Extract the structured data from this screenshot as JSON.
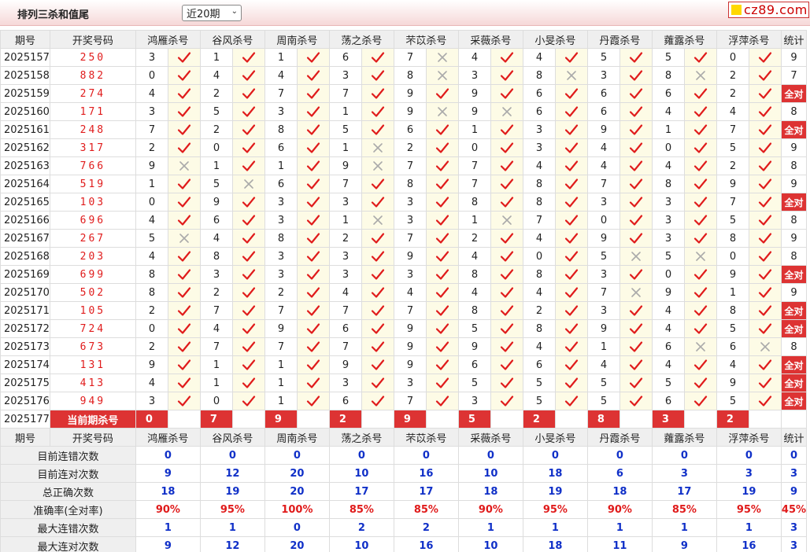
{
  "header": {
    "title": "排列三杀和值尾",
    "period_select": "近20期",
    "logo_text": "cz89.com"
  },
  "columns": {
    "period": "期号",
    "draw": "开奖号码",
    "experts": [
      "鸿雁杀号",
      "谷风杀号",
      "周南杀号",
      "荡之杀号",
      "芣苡杀号",
      "采薇杀号",
      "小旻杀号",
      "丹霞杀号",
      "蕹露杀号",
      "浮萍杀号"
    ],
    "count": "统计"
  },
  "full_label": "全对",
  "rows": [
    {
      "period": "2025157",
      "draw": "250",
      "kills": [
        3,
        1,
        1,
        6,
        7,
        4,
        4,
        5,
        5,
        0
      ],
      "hits": [
        1,
        1,
        1,
        1,
        0,
        1,
        1,
        1,
        1,
        1
      ],
      "count": "9"
    },
    {
      "period": "2025158",
      "draw": "882",
      "kills": [
        0,
        4,
        4,
        3,
        8,
        3,
        8,
        3,
        8,
        2
      ],
      "hits": [
        1,
        1,
        1,
        1,
        0,
        1,
        0,
        1,
        0,
        1
      ],
      "count": "7"
    },
    {
      "period": "2025159",
      "draw": "274",
      "kills": [
        4,
        2,
        7,
        7,
        9,
        9,
        6,
        6,
        6,
        2
      ],
      "hits": [
        1,
        1,
        1,
        1,
        1,
        1,
        1,
        1,
        1,
        1
      ],
      "count": "全对"
    },
    {
      "period": "2025160",
      "draw": "171",
      "kills": [
        3,
        5,
        3,
        1,
        9,
        9,
        6,
        6,
        4,
        4
      ],
      "hits": [
        1,
        1,
        1,
        1,
        0,
        0,
        1,
        1,
        1,
        1
      ],
      "count": "8"
    },
    {
      "period": "2025161",
      "draw": "248",
      "kills": [
        7,
        2,
        8,
        5,
        6,
        1,
        3,
        9,
        1,
        7
      ],
      "hits": [
        1,
        1,
        1,
        1,
        1,
        1,
        1,
        1,
        1,
        1
      ],
      "count": "全对"
    },
    {
      "period": "2025162",
      "draw": "317",
      "kills": [
        2,
        0,
        6,
        1,
        2,
        0,
        3,
        4,
        0,
        5
      ],
      "hits": [
        1,
        1,
        1,
        0,
        1,
        1,
        1,
        1,
        1,
        1
      ],
      "count": "9"
    },
    {
      "period": "2025163",
      "draw": "766",
      "kills": [
        9,
        1,
        1,
        9,
        7,
        7,
        4,
        4,
        4,
        2
      ],
      "hits": [
        0,
        1,
        1,
        0,
        1,
        1,
        1,
        1,
        1,
        1
      ],
      "count": "8"
    },
    {
      "period": "2025164",
      "draw": "519",
      "kills": [
        1,
        5,
        6,
        7,
        8,
        7,
        8,
        7,
        8,
        9
      ],
      "hits": [
        1,
        0,
        1,
        1,
        1,
        1,
        1,
        1,
        1,
        1
      ],
      "count": "9"
    },
    {
      "period": "2025165",
      "draw": "103",
      "kills": [
        0,
        9,
        3,
        3,
        3,
        8,
        8,
        3,
        3,
        7
      ],
      "hits": [
        1,
        1,
        1,
        1,
        1,
        1,
        1,
        1,
        1,
        1
      ],
      "count": "全对"
    },
    {
      "period": "2025166",
      "draw": "696",
      "kills": [
        4,
        6,
        3,
        1,
        3,
        1,
        7,
        0,
        3,
        5
      ],
      "hits": [
        1,
        1,
        1,
        0,
        1,
        0,
        1,
        1,
        1,
        1
      ],
      "count": "8"
    },
    {
      "period": "2025167",
      "draw": "267",
      "kills": [
        5,
        4,
        8,
        2,
        7,
        2,
        4,
        9,
        3,
        8
      ],
      "hits": [
        0,
        1,
        1,
        1,
        1,
        1,
        1,
        1,
        1,
        1
      ],
      "count": "9"
    },
    {
      "period": "2025168",
      "draw": "203",
      "kills": [
        4,
        8,
        3,
        3,
        9,
        4,
        0,
        5,
        5,
        0
      ],
      "hits": [
        1,
        1,
        1,
        1,
        1,
        1,
        1,
        0,
        0,
        1
      ],
      "count": "8"
    },
    {
      "period": "2025169",
      "draw": "699",
      "kills": [
        8,
        3,
        3,
        3,
        3,
        8,
        8,
        3,
        0,
        9
      ],
      "hits": [
        1,
        1,
        1,
        1,
        1,
        1,
        1,
        1,
        1,
        1
      ],
      "count": "全对"
    },
    {
      "period": "2025170",
      "draw": "502",
      "kills": [
        8,
        2,
        2,
        4,
        4,
        4,
        4,
        7,
        9,
        1
      ],
      "hits": [
        1,
        1,
        1,
        1,
        1,
        1,
        1,
        0,
        1,
        1
      ],
      "count": "9"
    },
    {
      "period": "2025171",
      "draw": "105",
      "kills": [
        2,
        7,
        7,
        7,
        7,
        8,
        2,
        3,
        4,
        8
      ],
      "hits": [
        1,
        1,
        1,
        1,
        1,
        1,
        1,
        1,
        1,
        1
      ],
      "count": "全对"
    },
    {
      "period": "2025172",
      "draw": "724",
      "kills": [
        0,
        4,
        9,
        6,
        9,
        5,
        8,
        9,
        4,
        5
      ],
      "hits": [
        1,
        1,
        1,
        1,
        1,
        1,
        1,
        1,
        1,
        1
      ],
      "count": "全对"
    },
    {
      "period": "2025173",
      "draw": "673",
      "kills": [
        2,
        7,
        7,
        7,
        9,
        9,
        4,
        1,
        6,
        6
      ],
      "hits": [
        1,
        1,
        1,
        1,
        1,
        1,
        1,
        1,
        0,
        0
      ],
      "count": "8"
    },
    {
      "period": "2025174",
      "draw": "131",
      "kills": [
        9,
        1,
        1,
        9,
        9,
        6,
        6,
        4,
        4,
        4
      ],
      "hits": [
        1,
        1,
        1,
        1,
        1,
        1,
        1,
        1,
        1,
        1
      ],
      "count": "全对"
    },
    {
      "period": "2025175",
      "draw": "413",
      "kills": [
        4,
        1,
        1,
        3,
        3,
        5,
        5,
        5,
        5,
        9
      ],
      "hits": [
        1,
        1,
        1,
        1,
        1,
        1,
        1,
        1,
        1,
        1
      ],
      "count": "全对"
    },
    {
      "period": "2025176",
      "draw": "949",
      "kills": [
        3,
        0,
        1,
        6,
        7,
        3,
        5,
        5,
        6,
        5
      ],
      "hits": [
        1,
        1,
        1,
        1,
        1,
        1,
        1,
        1,
        1,
        1
      ],
      "count": "全对"
    }
  ],
  "current": {
    "period": "2025177",
    "label": "当前期杀号",
    "kills": [
      0,
      7,
      9,
      2,
      9,
      5,
      2,
      8,
      3,
      2
    ]
  },
  "stats": [
    {
      "label": "目前连错次数",
      "values": [
        "0",
        "0",
        "0",
        "0",
        "0",
        "0",
        "0",
        "0",
        "0",
        "0"
      ],
      "count": "0",
      "red": false
    },
    {
      "label": "目前连对次数",
      "values": [
        "9",
        "12",
        "20",
        "10",
        "16",
        "10",
        "18",
        "6",
        "3",
        "3"
      ],
      "count": "3",
      "red": false
    },
    {
      "label": "总正确次数",
      "values": [
        "18",
        "19",
        "20",
        "17",
        "17",
        "18",
        "19",
        "18",
        "17",
        "19"
      ],
      "count": "9",
      "red": false
    },
    {
      "label": "准确率(全对率)",
      "values": [
        "90%",
        "95%",
        "100%",
        "85%",
        "85%",
        "90%",
        "95%",
        "90%",
        "85%",
        "95%"
      ],
      "count": "45%",
      "red": true
    },
    {
      "label": "最大连错次数",
      "values": [
        "1",
        "1",
        "0",
        "2",
        "2",
        "1",
        "1",
        "1",
        "1",
        "1"
      ],
      "count": "3",
      "red": false
    },
    {
      "label": "最大连对次数",
      "values": [
        "9",
        "12",
        "20",
        "10",
        "16",
        "10",
        "18",
        "11",
        "9",
        "16"
      ],
      "count": "3",
      "red": false
    }
  ],
  "colors": {
    "accent_red": "#e01b1b",
    "stat_blue": "#1030c8",
    "mark_bg": "#fdfbe6"
  }
}
